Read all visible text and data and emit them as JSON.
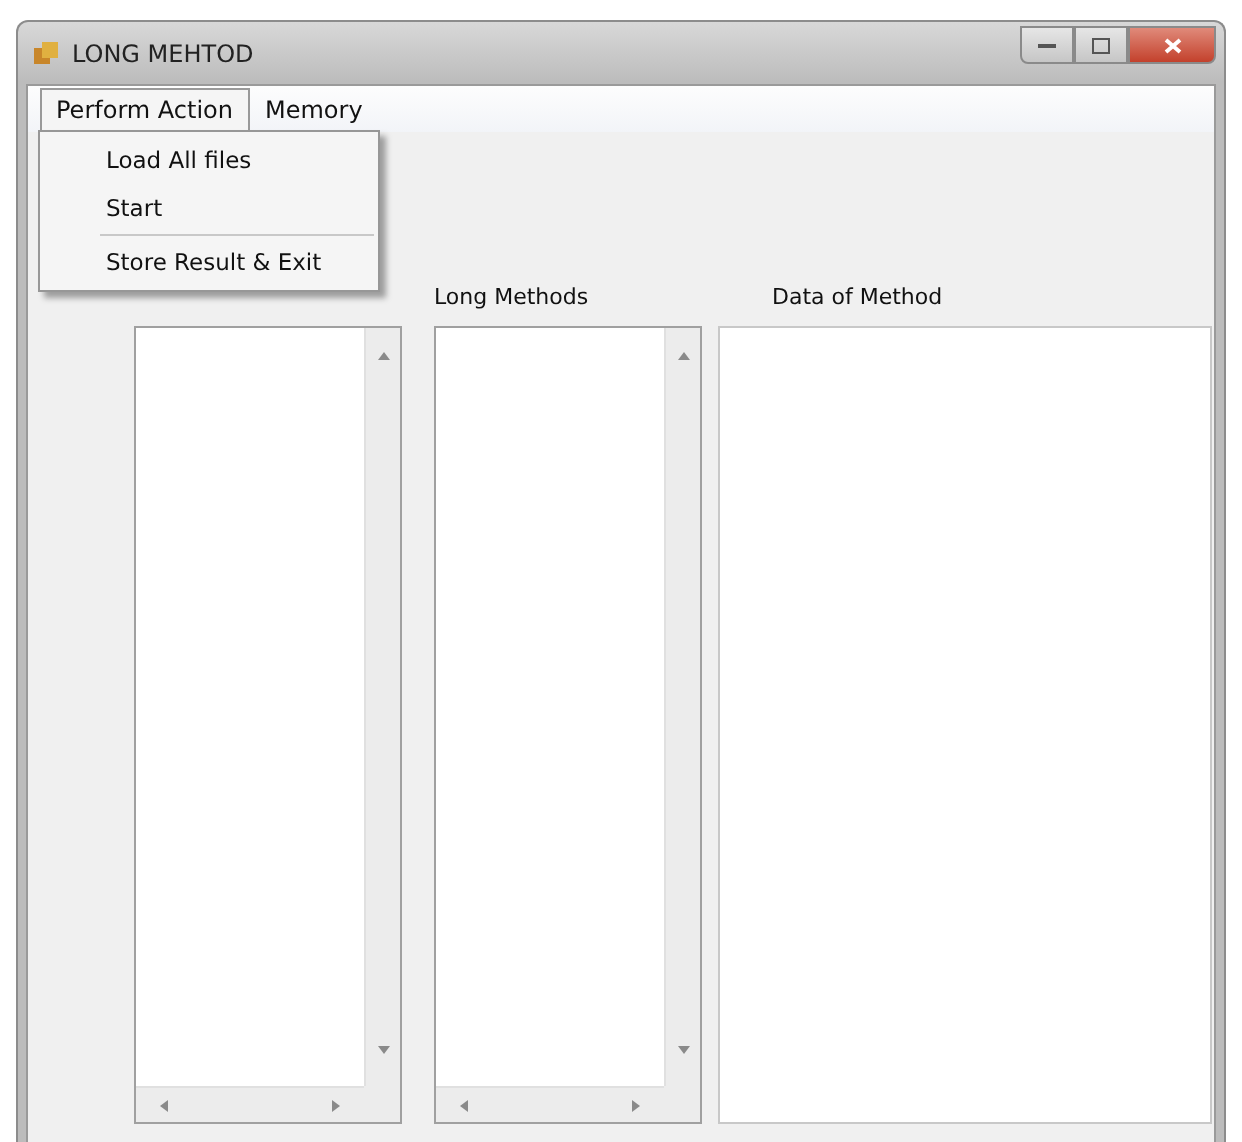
{
  "window": {
    "title": "LONG MEHTOD"
  },
  "menu_bar": {
    "items": [
      {
        "label": "Perform Action",
        "selected": true
      },
      {
        "label": "Memory",
        "selected": false
      }
    ]
  },
  "dropdown": {
    "items": [
      {
        "label": "Load All files",
        "separator_after": false
      },
      {
        "label": "Start",
        "separator_after": true
      },
      {
        "label": "Store Result & Exit",
        "separator_after": false
      }
    ]
  },
  "panels": [
    {
      "kind": "listbox"
    },
    {
      "kind": "listbox",
      "label": "Long Methods"
    },
    {
      "kind": "textbox",
      "label": "Data of Method"
    }
  ]
}
